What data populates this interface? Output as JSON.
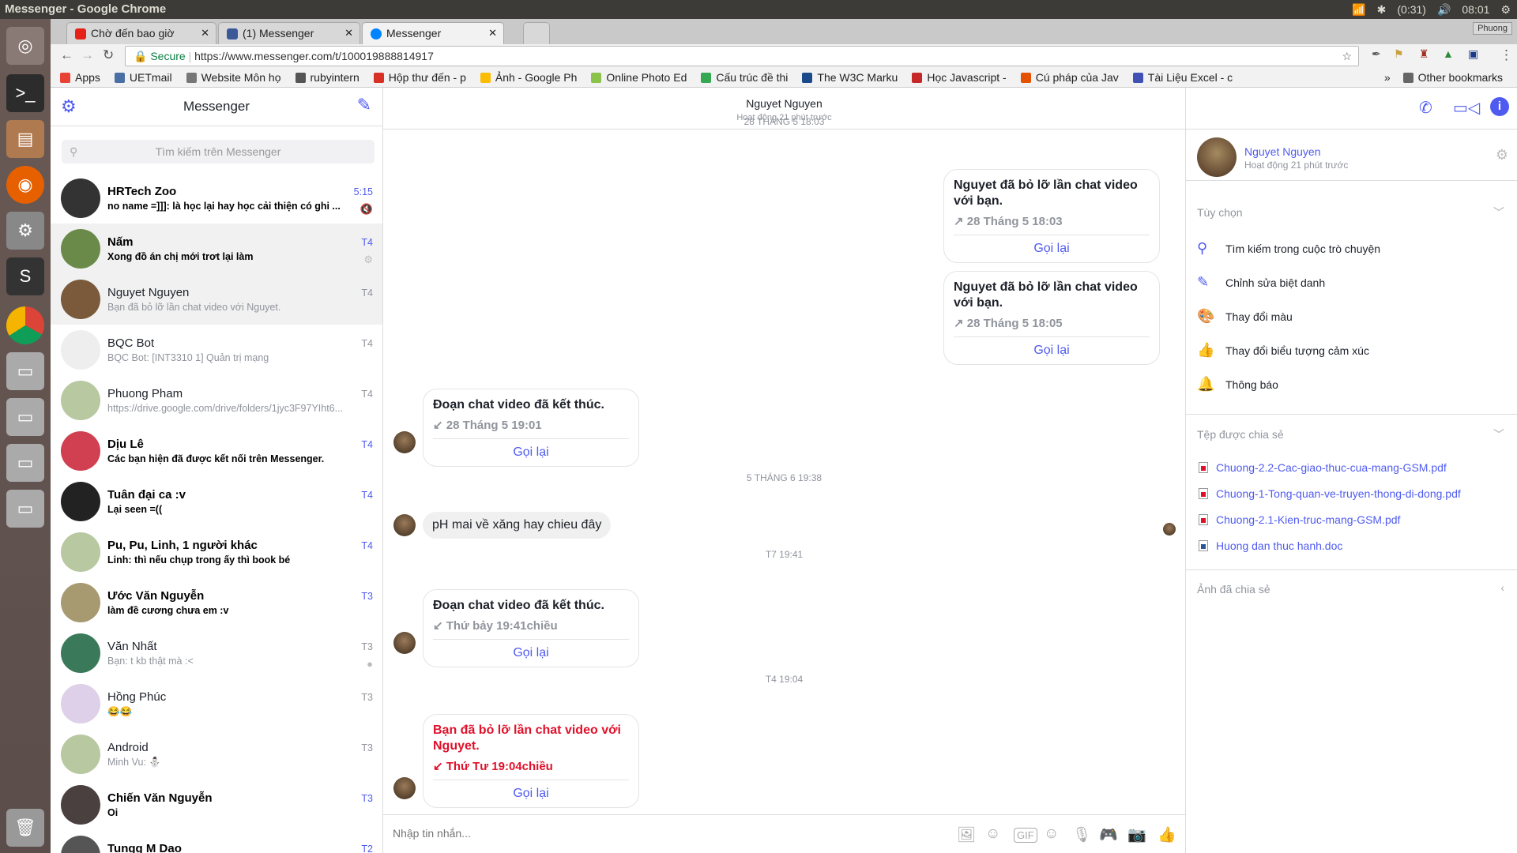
{
  "window": {
    "title": "Messenger - Google Chrome",
    "battery": "(0:31)",
    "clock": "08:01",
    "profile": "Phuong"
  },
  "tabs": [
    {
      "label": "Chờ đến bao giờ",
      "color": "#e62117",
      "audio": "🔈"
    },
    {
      "label": "(1) Messenger",
      "color": "#3b5998"
    },
    {
      "label": "Messenger",
      "color": "#0084ff"
    }
  ],
  "address": {
    "secure": "Secure",
    "url": "https://www.messenger.com/t/100019888814917"
  },
  "bookmarks": [
    {
      "label": "Apps",
      "color": "#e94235"
    },
    {
      "label": "UETmail",
      "color": "#4a6fa5"
    },
    {
      "label": "Website Môn họ",
      "color": "#777"
    },
    {
      "label": "rubyintern",
      "color": "#555"
    },
    {
      "label": "Hộp thư đến - p",
      "color": "#d93025"
    },
    {
      "label": "Ảnh - Google Ph",
      "color": "#fbbc04"
    },
    {
      "label": "Online Photo Ed",
      "color": "#8bc34a"
    },
    {
      "label": "Cấu trúc đề thi",
      "color": "#34a853"
    },
    {
      "label": "The W3C Marku",
      "color": "#1a4a8a"
    },
    {
      "label": "Học Javascript -",
      "color": "#c62828"
    },
    {
      "label": "Cú pháp của Jav",
      "color": "#e65100"
    },
    {
      "label": "Tài Liệu Excel - c",
      "color": "#3f51b5"
    }
  ],
  "bookmarks_more": "»",
  "other_bookmarks": "Other bookmarks",
  "sidebar": {
    "title": "Messenger",
    "search_placeholder": "Tìm kiếm trên Messenger",
    "conversations": [
      {
        "name": "HRTech Zoo",
        "snippet": "no name =]]]: là học lại hay học cải thiện có ghi ...",
        "time": "5:15",
        "unread": true,
        "extra": "🔇",
        "avatar": "#333"
      },
      {
        "name": "Nấm",
        "snippet": "Xong đồ án chị mới trơt lại làm",
        "time": "T4",
        "unread": true,
        "extra": "⚙",
        "avatar": "#6a8a4a",
        "selected": true
      },
      {
        "name": "Nguyet Nguyen",
        "snippet": "Bạn đã bỏ lỡ lần chat video với Nguyet.",
        "time": "T4",
        "unread": false,
        "avatar": "#7a5a3a",
        "selected": true
      },
      {
        "name": "BQC Bot",
        "snippet": "BQC Bot: [INT3310 1] Quản trị mạng",
        "time": "T4",
        "unread": false,
        "avatar": "#eee"
      },
      {
        "name": "Phuong Pham",
        "snippet": "https://drive.google.com/drive/folders/1jyc3F97YIht6...",
        "time": "T4",
        "unread": false,
        "avatar": "#b8c8a0"
      },
      {
        "name": "Dịu Lê",
        "snippet": "Các bạn hiện đã được kết nối trên Messenger.",
        "time": "T4",
        "unread": true,
        "avatar": "#d04050"
      },
      {
        "name": "Tuân đại ca :v",
        "snippet": "Lại seen =((",
        "time": "T4",
        "unread": true,
        "avatar": "#222"
      },
      {
        "name": "Pu, Pu, Linh, 1 người khác",
        "snippet": "Linh: thì nếu chụp trong ấy thì book bé",
        "time": "T4",
        "unread": true,
        "avatar": "#b8c8a0"
      },
      {
        "name": "Ước Văn Nguyễn",
        "snippet": "làm đề cương chưa em :v",
        "time": "T3",
        "unread": true,
        "avatar": "#a89a70"
      },
      {
        "name": "Văn Nhất",
        "snippet": "Bạn: t kb thật mà :<",
        "time": "T3",
        "unread": false,
        "extra": "●",
        "avatar": "#3a7a5a"
      },
      {
        "name": "Hồng Phúc",
        "snippet": "😂😂",
        "time": "T3",
        "unread": false,
        "avatar": "#ddd0e8"
      },
      {
        "name": "Android",
        "snippet": "Minh Vu: ⛄",
        "time": "T3",
        "unread": false,
        "avatar": "#b8c8a0"
      },
      {
        "name": "Chiến Văn Nguyễn",
        "snippet": "Oi",
        "time": "T3",
        "unread": true,
        "avatar": "#4a4040"
      },
      {
        "name": "Tungg M Dao",
        "snippet": "",
        "time": "T2",
        "unread": true,
        "avatar": "#555"
      }
    ]
  },
  "chat": {
    "name": "Nguyet Nguyen",
    "status": "Hoạt động 21 phút trước",
    "dates": [
      "28 THÁNG 5 18:03",
      "5 THÁNG 6 19:38",
      "T7 19:41",
      "T4 19:04"
    ],
    "calls": [
      {
        "title": "Nguyet đã bỏ lỡ lần chat video với bạn.",
        "sub": "↗ 28 Tháng 5 18:03",
        "action": "Gọi lại",
        "side": "right"
      },
      {
        "title": "Nguyet đã bỏ lỡ lần chat video với bạn.",
        "sub": "↗ 28 Tháng 5 18:05",
        "action": "Gọi lại",
        "side": "right"
      },
      {
        "title": "Đoạn chat video đã kết thúc.",
        "sub": "↙ 28 Tháng 5 19:01",
        "action": "Gọi lại",
        "side": "left"
      },
      {
        "title": "Đoạn chat video đã kết thúc.",
        "sub": "↙ Thứ bảy 19:41chiều",
        "action": "Gọi lại",
        "side": "left"
      },
      {
        "title": "Bạn đã bỏ lỡ lần chat video với Nguyet.",
        "sub": "↙ Thứ Tư 19:04chiều",
        "action": "Gọi lại",
        "side": "left",
        "missed": true
      }
    ],
    "text_message": "pH mai về xăng hay chieu đây",
    "composer_placeholder": "Nhập tin nhắn..."
  },
  "right": {
    "name": "Nguyet Nguyen",
    "status": "Hoạt động 21 phút trước",
    "options_title": "Tùy chọn",
    "options": [
      {
        "icon": "search-icon",
        "glyph": "⚲",
        "label": "Tìm kiếm trong cuộc trò chuyện"
      },
      {
        "icon": "pencil-icon",
        "glyph": "✎",
        "label": "Chỉnh sửa biệt danh"
      },
      {
        "icon": "palette-icon",
        "glyph": "🎨",
        "label": "Thay đổi màu"
      },
      {
        "icon": "thumbs-up-icon",
        "glyph": "👍",
        "label": "Thay đổi biểu tượng cảm xúc"
      },
      {
        "icon": "bell-icon",
        "glyph": "🔔",
        "label": "Thông báo"
      }
    ],
    "files_title": "Tệp được chia sẻ",
    "files": [
      {
        "name": "Chuong-2.2-Cac-giao-thuc-cua-mang-GSM.pdf",
        "type": "pdf"
      },
      {
        "name": "Chuong-1-Tong-quan-ve-truyen-thong-di-dong.pdf",
        "type": "pdf"
      },
      {
        "name": "Chuong-2.1-Kien-truc-mang-GSM.pdf",
        "type": "pdf"
      },
      {
        "name": "Huong dan thuc hanh.doc",
        "type": "doc"
      }
    ],
    "photos_title": "Ảnh đã chia sẻ"
  },
  "colors": {
    "accent": "#4f5bf0",
    "missed": "#e0102a"
  }
}
